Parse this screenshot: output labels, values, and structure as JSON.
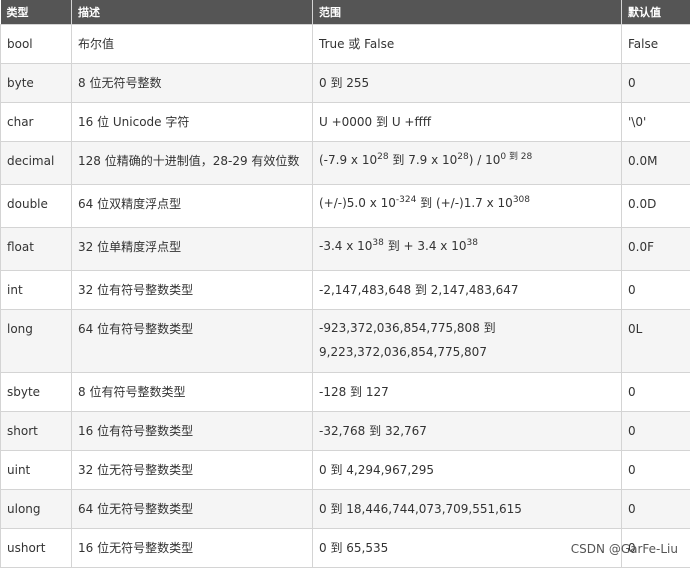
{
  "header": [
    "类型",
    "描述",
    "范围",
    "默认值"
  ],
  "rows": [
    {
      "type": "bool",
      "desc": "布尔值",
      "range": "True 或 False",
      "default": "False"
    },
    {
      "type": "byte",
      "desc": "8 位无符号整数",
      "range": "0 到 255",
      "default": "0"
    },
    {
      "type": "char",
      "desc": "16 位 Unicode 字符",
      "range": "U +0000 到 U +ffff",
      "default": "'\\0'"
    },
    {
      "type": "decimal",
      "desc": "128 位精确的十进制值，28-29 有效位数",
      "range_parts": {
        "a": "(-7.9 x 10",
        "a_exp": "28",
        "b": " 到 7.9 x 10",
        "b_exp": "28",
        "c": ") / 10",
        "c_exp": "0 到 28"
      },
      "default": "0.0M"
    },
    {
      "type": "double",
      "desc": "64 位双精度浮点型",
      "range_parts": {
        "a": "(+/-)5.0 x 10",
        "a_exp": "-324",
        "b": " 到 (+/-)1.7 x 10",
        "b_exp": "308"
      },
      "default": "0.0D"
    },
    {
      "type": "float",
      "desc": "32 位单精度浮点型",
      "range_parts": {
        "a": "-3.4 x 10",
        "a_exp": "38",
        "b": " 到 + 3.4 x 10",
        "b_exp": "38"
      },
      "default": "0.0F"
    },
    {
      "type": "int",
      "desc": "32 位有符号整数类型",
      "range": "-2,147,483,648 到 2,147,483,647",
      "default": "0"
    },
    {
      "type": "long",
      "desc": "64 位有符号整数类型",
      "range_line1": "-923,372,036,854,775,808 到",
      "range_line2": "9,223,372,036,854,775,807",
      "default": "0L"
    },
    {
      "type": "sbyte",
      "desc": "8 位有符号整数类型",
      "range": "-128 到 127",
      "default": "0"
    },
    {
      "type": "short",
      "desc": "16 位有符号整数类型",
      "range": "-32,768 到 32,767",
      "default": "0"
    },
    {
      "type": "uint",
      "desc": "32 位无符号整数类型",
      "range": "0 到 4,294,967,295",
      "default": "0"
    },
    {
      "type": "ulong",
      "desc": "64 位无符号整数类型",
      "range": "0 到 18,446,744,073,709,551,615",
      "default": "0"
    },
    {
      "type": "ushort",
      "desc": "16 位无符号整数类型",
      "range": "0 到 65,535",
      "default": "0"
    }
  ],
  "watermark": "CSDN @GarFe-Liu"
}
